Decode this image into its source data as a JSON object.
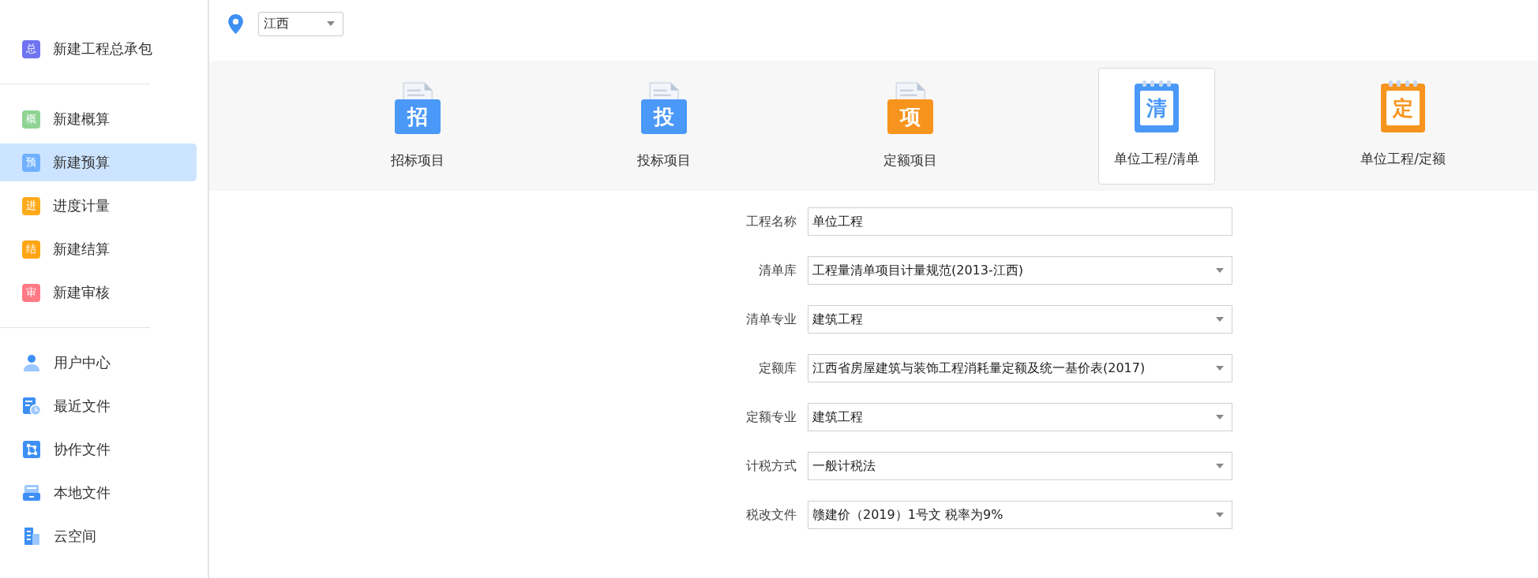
{
  "sidebar": {
    "groups": [
      {
        "items": [
          {
            "kind": "badge",
            "badge": "总",
            "color": "#6f74f0",
            "label": "新建工程总承包",
            "selected": false
          }
        ]
      },
      {
        "items": [
          {
            "kind": "badge",
            "badge": "概",
            "color": "#8fd494",
            "label": "新建概算",
            "selected": false
          },
          {
            "kind": "badge",
            "badge": "预",
            "color": "#6fb1ff",
            "label": "新建预算",
            "selected": true
          },
          {
            "kind": "badge",
            "badge": "进",
            "color": "#ffaa1a",
            "label": "进度计量",
            "selected": false
          },
          {
            "kind": "badge",
            "badge": "结",
            "color": "#ffa514",
            "label": "新建结算",
            "selected": false
          },
          {
            "kind": "badge",
            "badge": "审",
            "color": "#ff7a85",
            "label": "新建审核",
            "selected": false
          }
        ]
      },
      {
        "items": [
          {
            "kind": "user",
            "label": "用户中心",
            "selected": false
          },
          {
            "kind": "recent",
            "label": "最近文件",
            "selected": false
          },
          {
            "kind": "collab",
            "label": "协作文件",
            "selected": false
          },
          {
            "kind": "local",
            "label": "本地文件",
            "selected": false
          },
          {
            "kind": "cloud",
            "label": "云空间",
            "selected": false
          }
        ]
      }
    ]
  },
  "region": {
    "value": "江西"
  },
  "project_types": [
    {
      "kind": "folder",
      "badge": "招",
      "color": "#4a98f7",
      "label": "招标项目",
      "selected": false
    },
    {
      "kind": "folder",
      "badge": "投",
      "color": "#4a98f7",
      "label": "投标项目",
      "selected": false
    },
    {
      "kind": "folder",
      "badge": "项",
      "color": "#f7941d",
      "label": "定额项目",
      "selected": false
    },
    {
      "kind": "notebook",
      "badge": "清",
      "color": "#4a98f7",
      "label": "单位工程/清单",
      "selected": true
    },
    {
      "kind": "notebook",
      "badge": "定",
      "color": "#f7941d",
      "label": "单位工程/定额",
      "selected": false
    }
  ],
  "form": [
    {
      "kind": "text",
      "label": "工程名称",
      "value": "单位工程"
    },
    {
      "kind": "select",
      "label": "清单库",
      "value": "工程量清单项目计量规范(2013-江西)"
    },
    {
      "kind": "select",
      "label": "清单专业",
      "value": "建筑工程"
    },
    {
      "kind": "select",
      "label": "定额库",
      "value": "江西省房屋建筑与装饰工程消耗量定额及统一基价表(2017)"
    },
    {
      "kind": "select",
      "label": "定额专业",
      "value": "建筑工程"
    },
    {
      "kind": "select",
      "label": "计税方式",
      "value": "一般计税法"
    },
    {
      "kind": "select",
      "label": "税改文件",
      "value": "赣建价（2019）1号文 税率为9%"
    }
  ]
}
